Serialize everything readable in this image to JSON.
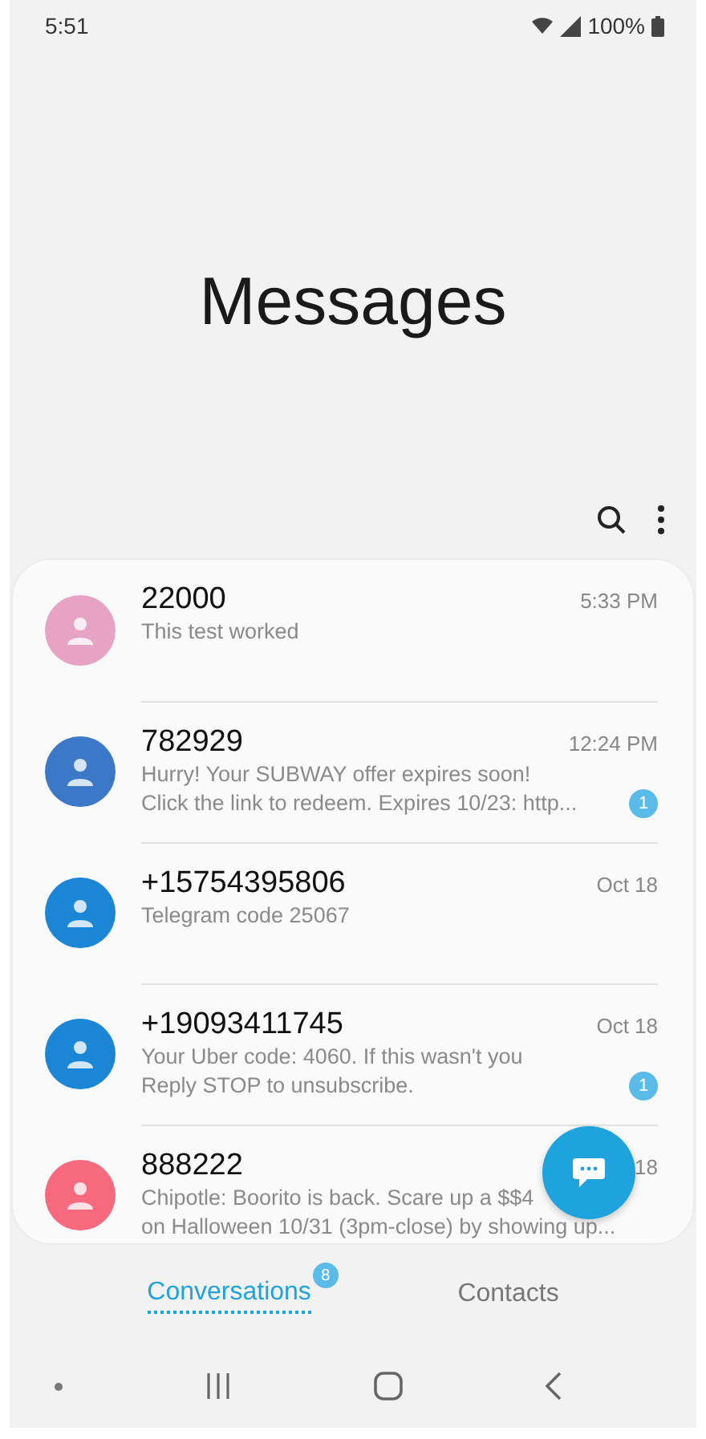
{
  "status_bar": {
    "time": "5:51",
    "battery": "100%"
  },
  "title": "Messages",
  "conversations": [
    {
      "name": "22000",
      "time": "5:33 PM",
      "preview": [
        "This test worked"
      ],
      "color": "#e6a3c3"
    },
    {
      "name": "782929",
      "time": "12:24 PM",
      "preview": [
        "Hurry! Your SUBWAY offer expires soon!",
        "Click the link to redeem. Expires 10/23: http..."
      ],
      "unread": "1",
      "color": "#3b78c8"
    },
    {
      "name": "+15754395806",
      "time": "Oct 18",
      "preview": [
        "Telegram code 25067"
      ],
      "color": "#1c86d6"
    },
    {
      "name": "+19093411745",
      "time": "Oct 18",
      "preview": [
        "Your Uber code: 4060. If this wasn't you",
        "Reply STOP to unsubscribe."
      ],
      "unread": "1",
      "color": "#1c86d6"
    },
    {
      "name": "888222",
      "time": "18",
      "preview": [
        "Chipotle: Boorito is back. Scare up a $$4",
        "on Halloween 10/31 (3pm-close) by showing up..."
      ],
      "color": "#f76a7e"
    }
  ],
  "tabs": [
    {
      "label": "Conversations",
      "selected": true,
      "badge": "8"
    },
    {
      "label": "Contacts",
      "selected": false
    }
  ]
}
